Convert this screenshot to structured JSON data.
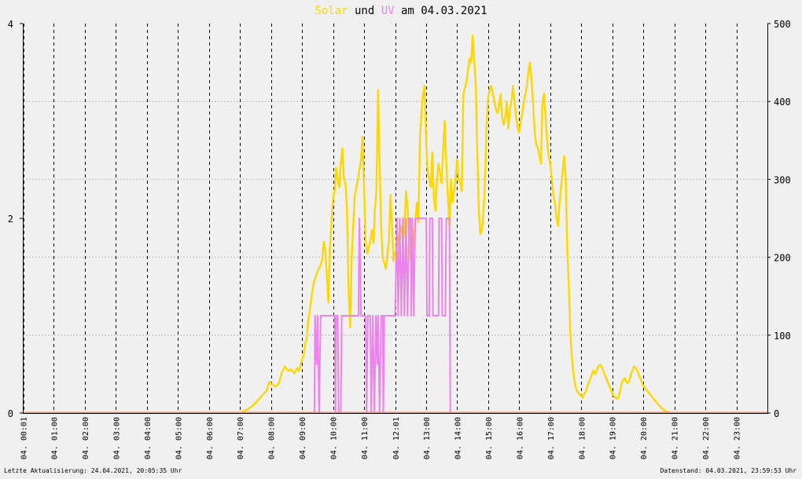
{
  "title": {
    "part1": "Solar",
    "part2": " und ",
    "part3": "UV",
    "part4": " am 04.03.2021"
  },
  "footer": {
    "left": "Letzte Aktualisierung: 24.04.2021, 20:05:35 Uhr",
    "right": "Datenstand: 04.03.2021, 23:59:53 Uhr"
  },
  "colors": {
    "background": "#f0f0f0",
    "solar": "#ffd700",
    "uv": "#ee82ee",
    "baseline": "#ff8866",
    "axis": "#000000",
    "grid_major": "#000000",
    "grid_minor": "#bbbbbb"
  },
  "chart_data": {
    "type": "line",
    "title": "Solar und UV am 04.03.2021",
    "x_tick_labels": [
      "04. 00:01",
      "04. 01:00",
      "04. 02:00",
      "04. 03:00",
      "04. 04:00",
      "04. 05:00",
      "04. 06:00",
      "04. 07:00",
      "04. 08:00",
      "04. 09:00",
      "04. 10:00",
      "04. 11:00",
      "04. 12:01",
      "04. 13:00",
      "04. 14:00",
      "04. 15:00",
      "04. 16:00",
      "04. 17:00",
      "04. 18:00",
      "04. 19:00",
      "04. 20:00",
      "04. 21:00",
      "04. 22:00",
      "04. 23:00"
    ],
    "x_tick_hours": [
      0.017,
      1,
      2,
      3,
      4,
      5,
      6,
      7,
      8,
      9,
      10,
      11,
      12.017,
      13,
      14,
      15,
      16,
      17,
      18,
      19,
      20,
      21,
      22,
      23
    ],
    "xlim": [
      0,
      24
    ],
    "y_left": {
      "lim": [
        0,
        4
      ],
      "ticks": [
        0,
        2,
        4
      ]
    },
    "y_right": {
      "lim": [
        0,
        500
      ],
      "ticks": [
        0,
        100,
        200,
        300,
        400,
        500
      ]
    },
    "grid": true,
    "series": [
      {
        "name": "Solar",
        "axis": "right",
        "color": "#ffd700",
        "points": [
          [
            0,
            0
          ],
          [
            7.0,
            0
          ],
          [
            7.1,
            2
          ],
          [
            7.25,
            5
          ],
          [
            7.4,
            9
          ],
          [
            7.55,
            15
          ],
          [
            7.7,
            22
          ],
          [
            7.85,
            28
          ],
          [
            7.95,
            40
          ],
          [
            8.05,
            36
          ],
          [
            8.15,
            34
          ],
          [
            8.25,
            38
          ],
          [
            8.35,
            52
          ],
          [
            8.45,
            60
          ],
          [
            8.55,
            54
          ],
          [
            8.65,
            56
          ],
          [
            8.75,
            51
          ],
          [
            8.85,
            58
          ],
          [
            8.9,
            54
          ],
          [
            8.95,
            62
          ],
          [
            9.05,
            75
          ],
          [
            9.1,
            90
          ],
          [
            9.15,
            95
          ],
          [
            9.2,
            118
          ],
          [
            9.25,
            132
          ],
          [
            9.3,
            148
          ],
          [
            9.35,
            162
          ],
          [
            9.4,
            170
          ],
          [
            9.5,
            182
          ],
          [
            9.6,
            190
          ],
          [
            9.65,
            197
          ],
          [
            9.7,
            220
          ],
          [
            9.75,
            210
          ],
          [
            9.8,
            175
          ],
          [
            9.85,
            142
          ],
          [
            9.9,
            210
          ],
          [
            9.95,
            245
          ],
          [
            10.0,
            275
          ],
          [
            10.05,
            285
          ],
          [
            10.1,
            315
          ],
          [
            10.15,
            300
          ],
          [
            10.2,
            290
          ],
          [
            10.25,
            320
          ],
          [
            10.3,
            340
          ],
          [
            10.35,
            300
          ],
          [
            10.4,
            295
          ],
          [
            10.45,
            260
          ],
          [
            10.5,
            160
          ],
          [
            10.55,
            110
          ],
          [
            10.6,
            200
          ],
          [
            10.7,
            280
          ],
          [
            10.8,
            300
          ],
          [
            10.9,
            325
          ],
          [
            10.95,
            355
          ],
          [
            11.0,
            290
          ],
          [
            11.05,
            220
          ],
          [
            11.1,
            205
          ],
          [
            11.2,
            220
          ],
          [
            11.25,
            235
          ],
          [
            11.3,
            218
          ],
          [
            11.35,
            262
          ],
          [
            11.4,
            288
          ],
          [
            11.45,
            415
          ],
          [
            11.5,
            320
          ],
          [
            11.55,
            240
          ],
          [
            11.6,
            200
          ],
          [
            11.7,
            185
          ],
          [
            11.8,
            220
          ],
          [
            11.85,
            280
          ],
          [
            11.9,
            240
          ],
          [
            11.95,
            195
          ],
          [
            12.0,
            205
          ],
          [
            12.05,
            210
          ],
          [
            12.1,
            222
          ],
          [
            12.2,
            240
          ],
          [
            12.25,
            220
          ],
          [
            12.3,
            235
          ],
          [
            12.35,
            285
          ],
          [
            12.4,
            265
          ],
          [
            12.45,
            225
          ],
          [
            12.5,
            195
          ],
          [
            12.55,
            205
          ],
          [
            12.6,
            218
          ],
          [
            12.7,
            270
          ],
          [
            12.75,
            245
          ],
          [
            12.8,
            352
          ],
          [
            12.85,
            385
          ],
          [
            12.9,
            410
          ],
          [
            12.95,
            420
          ],
          [
            13.0,
            350
          ],
          [
            13.05,
            310
          ],
          [
            13.1,
            300
          ],
          [
            13.15,
            290
          ],
          [
            13.2,
            335
          ],
          [
            13.25,
            275
          ],
          [
            13.3,
            260
          ],
          [
            13.35,
            300
          ],
          [
            13.4,
            320
          ],
          [
            13.5,
            295
          ],
          [
            13.55,
            340
          ],
          [
            13.6,
            375
          ],
          [
            13.65,
            320
          ],
          [
            13.7,
            280
          ],
          [
            13.75,
            240
          ],
          [
            13.8,
            300
          ],
          [
            13.85,
            270
          ],
          [
            13.9,
            285
          ],
          [
            13.95,
            300
          ],
          [
            14.0,
            325
          ],
          [
            14.05,
            300
          ],
          [
            14.1,
            295
          ],
          [
            14.15,
            285
          ],
          [
            14.2,
            410
          ],
          [
            14.3,
            425
          ],
          [
            14.35,
            440
          ],
          [
            14.4,
            455
          ],
          [
            14.45,
            450
          ],
          [
            14.5,
            485
          ],
          [
            14.6,
            420
          ],
          [
            14.65,
            330
          ],
          [
            14.7,
            260
          ],
          [
            14.75,
            230
          ],
          [
            14.8,
            235
          ],
          [
            14.85,
            260
          ],
          [
            14.9,
            300
          ],
          [
            14.95,
            370
          ],
          [
            15.0,
            405
          ],
          [
            15.05,
            415
          ],
          [
            15.1,
            420
          ],
          [
            15.15,
            410
          ],
          [
            15.2,
            400
          ],
          [
            15.25,
            390
          ],
          [
            15.3,
            385
          ],
          [
            15.35,
            395
          ],
          [
            15.4,
            410
          ],
          [
            15.45,
            380
          ],
          [
            15.5,
            370
          ],
          [
            15.55,
            380
          ],
          [
            15.6,
            400
          ],
          [
            15.65,
            365
          ],
          [
            15.7,
            390
          ],
          [
            15.75,
            400
          ],
          [
            15.8,
            420
          ],
          [
            15.85,
            400
          ],
          [
            15.9,
            380
          ],
          [
            15.95,
            365
          ],
          [
            16.0,
            360
          ],
          [
            16.05,
            375
          ],
          [
            16.1,
            385
          ],
          [
            16.15,
            400
          ],
          [
            16.2,
            410
          ],
          [
            16.25,
            420
          ],
          [
            16.3,
            440
          ],
          [
            16.35,
            450
          ],
          [
            16.4,
            425
          ],
          [
            16.45,
            395
          ],
          [
            16.5,
            360
          ],
          [
            16.55,
            345
          ],
          [
            16.6,
            340
          ],
          [
            16.65,
            330
          ],
          [
            16.7,
            320
          ],
          [
            16.75,
            400
          ],
          [
            16.8,
            410
          ],
          [
            16.85,
            380
          ],
          [
            16.9,
            350
          ],
          [
            16.95,
            330
          ],
          [
            17.0,
            320
          ],
          [
            17.05,
            300
          ],
          [
            17.1,
            280
          ],
          [
            17.15,
            270
          ],
          [
            17.2,
            250
          ],
          [
            17.25,
            240
          ],
          [
            17.3,
            270
          ],
          [
            17.35,
            290
          ],
          [
            17.4,
            310
          ],
          [
            17.45,
            330
          ],
          [
            17.5,
            300
          ],
          [
            17.55,
            210
          ],
          [
            17.6,
            160
          ],
          [
            17.65,
            100
          ],
          [
            17.7,
            70
          ],
          [
            17.75,
            50
          ],
          [
            17.8,
            36
          ],
          [
            17.85,
            30
          ],
          [
            17.9,
            26
          ],
          [
            17.95,
            24
          ],
          [
            18.0,
            22
          ],
          [
            18.05,
            20
          ],
          [
            18.1,
            25
          ],
          [
            18.15,
            28
          ],
          [
            18.2,
            35
          ],
          [
            18.25,
            40
          ],
          [
            18.3,
            45
          ],
          [
            18.35,
            50
          ],
          [
            18.4,
            55
          ],
          [
            18.45,
            50
          ],
          [
            18.5,
            55
          ],
          [
            18.55,
            60
          ],
          [
            18.6,
            62
          ],
          [
            18.65,
            60
          ],
          [
            18.7,
            55
          ],
          [
            18.75,
            50
          ],
          [
            18.8,
            45
          ],
          [
            18.85,
            40
          ],
          [
            18.9,
            35
          ],
          [
            18.95,
            30
          ],
          [
            19.0,
            25
          ],
          [
            19.1,
            20
          ],
          [
            19.15,
            18
          ],
          [
            19.2,
            20
          ],
          [
            19.25,
            28
          ],
          [
            19.3,
            38
          ],
          [
            19.35,
            42
          ],
          [
            19.4,
            45
          ],
          [
            19.45,
            40
          ],
          [
            19.5,
            38
          ],
          [
            19.55,
            42
          ],
          [
            19.6,
            50
          ],
          [
            19.65,
            55
          ],
          [
            19.7,
            60
          ],
          [
            19.75,
            58
          ],
          [
            19.8,
            55
          ],
          [
            19.85,
            50
          ],
          [
            19.9,
            45
          ],
          [
            19.95,
            40
          ],
          [
            20.0,
            35
          ],
          [
            20.1,
            30
          ],
          [
            20.2,
            25
          ],
          [
            20.3,
            20
          ],
          [
            20.4,
            15
          ],
          [
            20.5,
            10
          ],
          [
            20.6,
            6
          ],
          [
            20.7,
            3
          ],
          [
            20.8,
            1
          ],
          [
            20.9,
            0
          ],
          [
            24,
            0
          ]
        ]
      },
      {
        "name": "UV",
        "axis": "left",
        "color": "#ee82ee",
        "points": [
          [
            0,
            0
          ],
          [
            9.4,
            0
          ],
          [
            9.42,
            1
          ],
          [
            9.47,
            0.5
          ],
          [
            9.5,
            1
          ],
          [
            9.55,
            0
          ],
          [
            9.6,
            1
          ],
          [
            10.05,
            1
          ],
          [
            10.08,
            0
          ],
          [
            10.1,
            1
          ],
          [
            10.15,
            1
          ],
          [
            10.18,
            0
          ],
          [
            10.25,
            0
          ],
          [
            10.28,
            1
          ],
          [
            10.82,
            1
          ],
          [
            10.85,
            2
          ],
          [
            10.9,
            1
          ],
          [
            11.05,
            1
          ],
          [
            11.08,
            0
          ],
          [
            11.12,
            1
          ],
          [
            11.2,
            1
          ],
          [
            11.23,
            0
          ],
          [
            11.28,
            1
          ],
          [
            11.33,
            0
          ],
          [
            11.38,
            1
          ],
          [
            11.42,
            0.5
          ],
          [
            11.45,
            1
          ],
          [
            11.5,
            0
          ],
          [
            11.55,
            1
          ],
          [
            11.6,
            1
          ],
          [
            11.62,
            0
          ],
          [
            11.65,
            1
          ],
          [
            12.0,
            1
          ],
          [
            12.03,
            1.5
          ],
          [
            12.06,
            2
          ],
          [
            12.1,
            1
          ],
          [
            12.15,
            2
          ],
          [
            12.2,
            1
          ],
          [
            12.25,
            2
          ],
          [
            12.3,
            1
          ],
          [
            12.35,
            2
          ],
          [
            12.4,
            1
          ],
          [
            12.45,
            2
          ],
          [
            12.5,
            2
          ],
          [
            12.52,
            1
          ],
          [
            12.56,
            2
          ],
          [
            12.6,
            1
          ],
          [
            12.65,
            2
          ],
          [
            13.0,
            2
          ],
          [
            13.03,
            1
          ],
          [
            13.1,
            1
          ],
          [
            13.12,
            2
          ],
          [
            13.2,
            2
          ],
          [
            13.22,
            1
          ],
          [
            13.4,
            1
          ],
          [
            13.42,
            2
          ],
          [
            13.5,
            2
          ],
          [
            13.52,
            1
          ],
          [
            13.62,
            1
          ],
          [
            13.65,
            2
          ],
          [
            13.75,
            2
          ],
          [
            13.78,
            0
          ],
          [
            24,
            0
          ]
        ]
      }
    ]
  }
}
